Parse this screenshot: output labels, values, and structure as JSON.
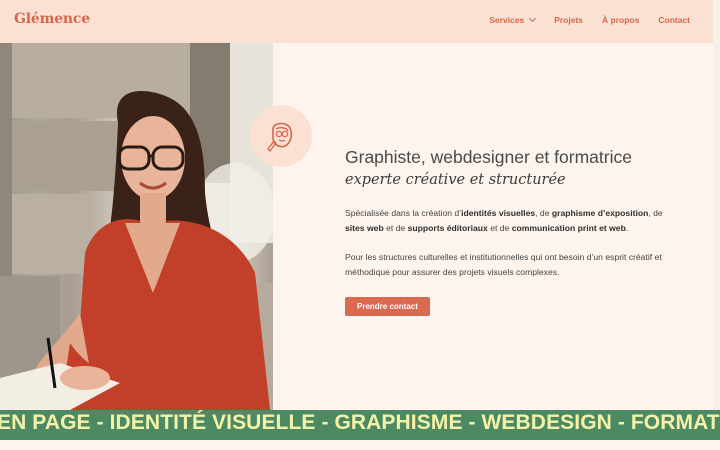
{
  "header": {
    "logo": "Glémence",
    "nav": [
      {
        "label": "Services",
        "dropdown": true
      },
      {
        "label": "Projets"
      },
      {
        "label": "À propos"
      },
      {
        "label": "Contact"
      }
    ]
  },
  "hero": {
    "headline": "Graphiste, webdesigner et formatrice",
    "subheadline": "experte créative et structurée",
    "intro": {
      "t1": "Spécialisée dans la création d’",
      "b1": "identités visuelles",
      "t2": ",  de ",
      "b2": "graphisme d’exposition",
      "t3": ", de ",
      "b3": "sites web",
      "t4": " et de ",
      "b4": "supports éditoriaux",
      "t5": " et de ",
      "b5": "communication print et web",
      "t6": "."
    },
    "paragraph2": "Pour les structures culturelles et institutionnelles qui ont besoin  d’un esprit créatif et méthodique pour assurer des projets visuels complexes.",
    "cta_label": "Prendre contact"
  },
  "banner": {
    "text": "EN PAGE - IDENTITÉ VISUELLE - GRAPHISME - WEBDESIGN - FORMATION"
  },
  "colors": {
    "accent": "#d4674d",
    "header_bg": "#fbe1d3",
    "page_bg": "#fdf4ee",
    "banner_bg": "#4c8a64",
    "banner_text": "#f5f2a7"
  },
  "icons": {
    "nav_dropdown": "chevron-down-icon",
    "badge": "illustrated-face-icon"
  }
}
